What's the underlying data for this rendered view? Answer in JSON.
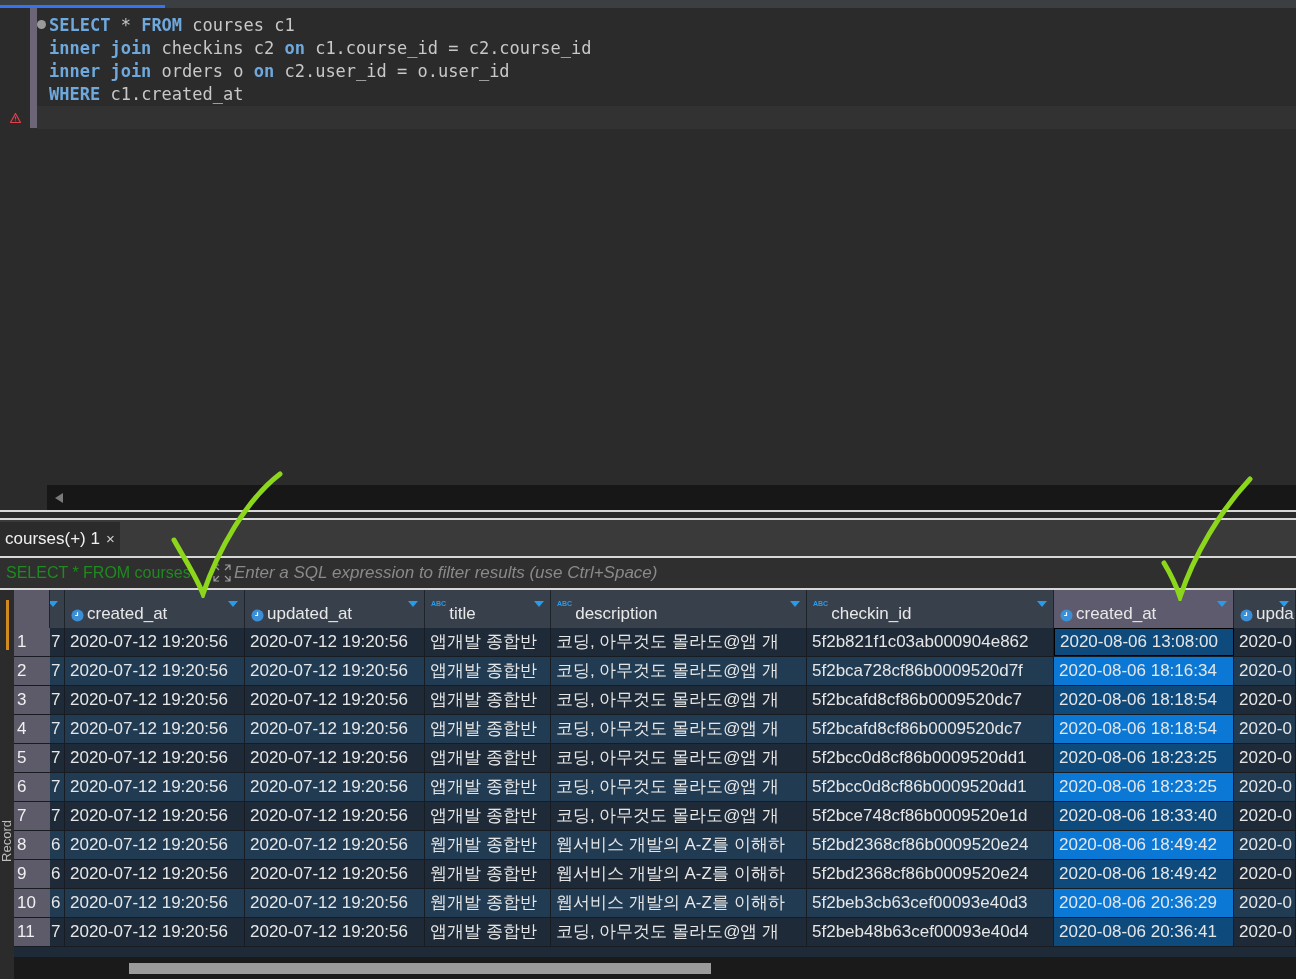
{
  "editor": {
    "lines": [
      [
        {
          "kind": "keyword",
          "text": "SELECT"
        },
        {
          "kind": "plain",
          "text": " * "
        },
        {
          "kind": "keyword",
          "text": "FROM"
        },
        {
          "kind": "plain",
          "text": " courses c1"
        }
      ],
      [
        {
          "kind": "keyword",
          "text": "inner join"
        },
        {
          "kind": "plain",
          "text": " checkins c2 "
        },
        {
          "kind": "keyword",
          "text": "on"
        },
        {
          "kind": "plain",
          "text": " c1.course_id = c2.course_id"
        }
      ],
      [
        {
          "kind": "keyword",
          "text": "inner join"
        },
        {
          "kind": "plain",
          "text": " orders o "
        },
        {
          "kind": "keyword",
          "text": "on"
        },
        {
          "kind": "plain",
          "text": " c2.user_id = o.user_id"
        }
      ],
      [
        {
          "kind": "keyword",
          "text": "WHERE"
        },
        {
          "kind": "plain",
          "text": " c1.created_at"
        }
      ]
    ]
  },
  "result_tab": {
    "label": "courses(+) 1",
    "close": "×"
  },
  "filter": {
    "query": "SELECT * FROM courses",
    "placeholder": "Enter a SQL expression to filter results (use Ctrl+Space)"
  },
  "side_label": "Record",
  "grid": {
    "columns": [
      {
        "kind": "clipped",
        "selected": false
      },
      {
        "kind": "datetime",
        "label": "created_at",
        "selected": false
      },
      {
        "kind": "datetime",
        "label": "updated_at",
        "selected": false
      },
      {
        "kind": "text",
        "badge": "ABC",
        "label": "title",
        "selected": false
      },
      {
        "kind": "text",
        "badge": "ABC",
        "label": "description",
        "selected": false
      },
      {
        "kind": "text",
        "badge": "ABC",
        "label": "checkin_id",
        "selected": false
      },
      {
        "kind": "datetime",
        "label": "created_at",
        "selected": true
      },
      {
        "kind": "datetime",
        "label": "upda",
        "selected": false
      }
    ],
    "rows": [
      {
        "number": "1",
        "focused": true,
        "cells": [
          "7",
          "2020-07-12 19:20:56",
          "2020-07-12 19:20:56",
          "앱개발 종합반",
          "코딩, 아무것도 몰라도@앱 개",
          "5f2b821f1c03ab000904e862",
          "2020-08-06 13:08:00",
          "2020-0"
        ]
      },
      {
        "number": "2",
        "focused": false,
        "cells": [
          "7",
          "2020-07-12 19:20:56",
          "2020-07-12 19:20:56",
          "앱개발 종합반",
          "코딩, 아무것도 몰라도@앱 개",
          "5f2bca728cf86b0009520d7f",
          "2020-08-06 18:16:34",
          "2020-0"
        ]
      },
      {
        "number": "3",
        "focused": false,
        "cells": [
          "7",
          "2020-07-12 19:20:56",
          "2020-07-12 19:20:56",
          "앱개발 종합반",
          "코딩, 아무것도 몰라도@앱 개",
          "5f2bcafd8cf86b0009520dc7",
          "2020-08-06 18:18:54",
          "2020-0"
        ]
      },
      {
        "number": "4",
        "focused": false,
        "cells": [
          "7",
          "2020-07-12 19:20:56",
          "2020-07-12 19:20:56",
          "앱개발 종합반",
          "코딩, 아무것도 몰라도@앱 개",
          "5f2bcafd8cf86b0009520dc7",
          "2020-08-06 18:18:54",
          "2020-0"
        ]
      },
      {
        "number": "5",
        "focused": false,
        "cells": [
          "7",
          "2020-07-12 19:20:56",
          "2020-07-12 19:20:56",
          "앱개발 종합반",
          "코딩, 아무것도 몰라도@앱 개",
          "5f2bcc0d8cf86b0009520dd1",
          "2020-08-06 18:23:25",
          "2020-0"
        ]
      },
      {
        "number": "6",
        "focused": false,
        "cells": [
          "7",
          "2020-07-12 19:20:56",
          "2020-07-12 19:20:56",
          "앱개발 종합반",
          "코딩, 아무것도 몰라도@앱 개",
          "5f2bcc0d8cf86b0009520dd1",
          "2020-08-06 18:23:25",
          "2020-0"
        ]
      },
      {
        "number": "7",
        "focused": false,
        "cells": [
          "7",
          "2020-07-12 19:20:56",
          "2020-07-12 19:20:56",
          "앱개발 종합반",
          "코딩, 아무것도 몰라도@앱 개",
          "5f2bce748cf86b0009520e1d",
          "2020-08-06 18:33:40",
          "2020-0"
        ]
      },
      {
        "number": "8",
        "focused": false,
        "cells": [
          "6",
          "2020-07-12 19:20:56",
          "2020-07-12 19:20:56",
          "웹개발 종합반",
          "웹서비스 개발의 A-Z를 이해하",
          "5f2bd2368cf86b0009520e24",
          "2020-08-06 18:49:42",
          "2020-0"
        ]
      },
      {
        "number": "9",
        "focused": false,
        "cells": [
          "6",
          "2020-07-12 19:20:56",
          "2020-07-12 19:20:56",
          "웹개발 종합반",
          "웹서비스 개발의 A-Z를 이해하",
          "5f2bd2368cf86b0009520e24",
          "2020-08-06 18:49:42",
          "2020-0"
        ]
      },
      {
        "number": "10",
        "focused": false,
        "cells": [
          "6",
          "2020-07-12 19:20:56",
          "2020-07-12 19:20:56",
          "웹개발 종합반",
          "웹서비스 개발의 A-Z를 이해하",
          "5f2beb3cb63cef00093e40d3",
          "2020-08-06 20:36:29",
          "2020-0"
        ]
      },
      {
        "number": "11",
        "focused": false,
        "cells": [
          "7",
          "2020-07-12 19:20:56",
          "2020-07-12 19:20:56",
          "앱개발 종합반",
          "코딩, 아무것도 몰라도@앱 개",
          "5f2beb48b63cef00093e40d4",
          "2020-08-06 20:36:41",
          "2020-0"
        ]
      }
    ]
  }
}
